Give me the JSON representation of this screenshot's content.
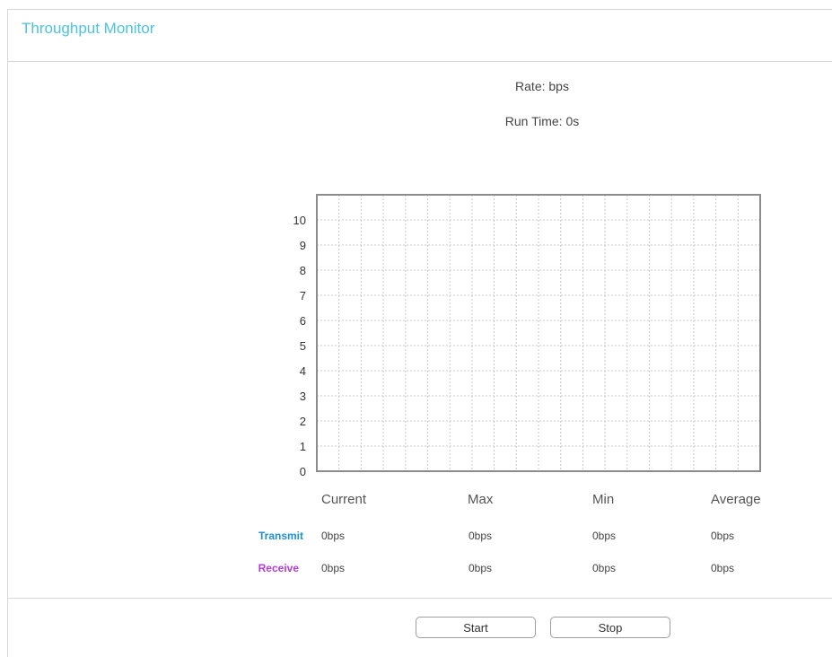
{
  "header": {
    "title": "Throughput Monitor"
  },
  "summary": {
    "rate": "Rate: bps",
    "run_time": "Run Time: 0s"
  },
  "chart_data": {
    "type": "line",
    "title": "",
    "xlabel": "",
    "ylabel": "",
    "ylim": [
      0,
      10
    ],
    "yticks": [
      "0",
      "1",
      "2",
      "3",
      "4",
      "5",
      "6",
      "7",
      "8",
      "9",
      "10"
    ],
    "grid": true,
    "series": []
  },
  "stats": {
    "columns": [
      "Current",
      "Max",
      "Min",
      "Average"
    ],
    "rows": [
      {
        "label": "Transmit",
        "color": "#1e90d8",
        "values": [
          "0bps",
          "0bps",
          "0bps",
          "0bps"
        ]
      },
      {
        "label": "Receive",
        "color": "#b13cd8",
        "values": [
          "0bps",
          "0bps",
          "0bps",
          "0bps"
        ]
      }
    ]
  },
  "buttons": {
    "start": "Start",
    "stop": "Stop"
  }
}
